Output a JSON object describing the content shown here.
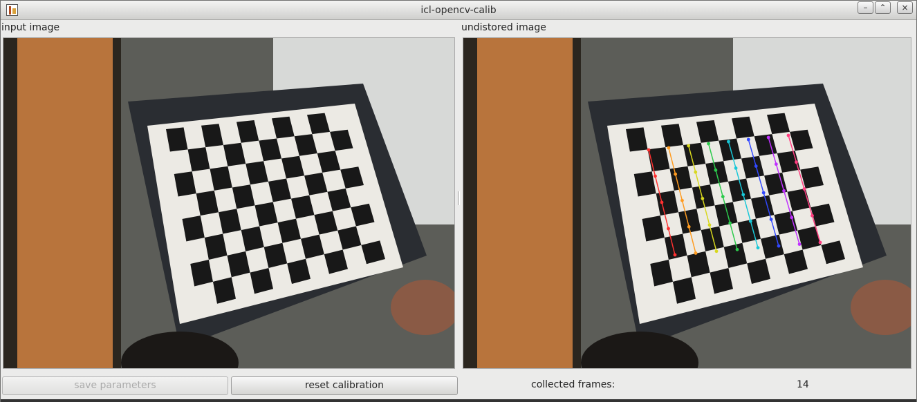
{
  "window": {
    "title": "icl-opencv-calib",
    "controls": [
      "minimize",
      "maximize",
      "close"
    ]
  },
  "panels": {
    "input_label": "input image",
    "undistorted_label": "undistored image"
  },
  "buttons": {
    "save": "save parameters",
    "reset": "reset calibration"
  },
  "status": {
    "collected_label": "collected frames:",
    "collected_value": "14"
  },
  "icons": {
    "app": "calibration-app-icon",
    "minimize": "minimize-icon",
    "maximize": "maximize-icon",
    "close": "close-icon"
  },
  "colors": {
    "wood": "#b8743c",
    "board_white": "#e9e7e1",
    "board_black": "#181818",
    "background": "#6f6f6b"
  }
}
